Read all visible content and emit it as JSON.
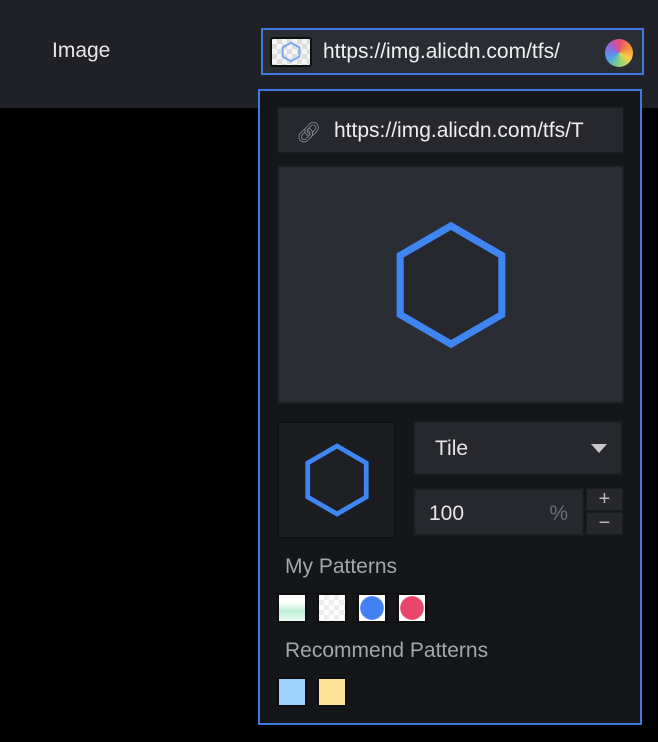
{
  "property_label": "Image",
  "field": {
    "value": "https://img.alicdn.com/tfs/",
    "thumb_icon": "hexagon-thumbnail",
    "color_icon": "color-wheel-icon"
  },
  "popover": {
    "url_input": {
      "icon": "link-icon",
      "value": "https://img.alicdn.com/tfs/T"
    },
    "fill_mode": {
      "selected": "Tile"
    },
    "scale": {
      "value": "100",
      "unit": "%",
      "increment": "+",
      "decrement": "−"
    },
    "my_patterns": {
      "title": "My Patterns",
      "items": [
        {
          "name": "pattern-green"
        },
        {
          "name": "pattern-white"
        },
        {
          "name": "pattern-blue-circle",
          "color": "#4180f0"
        },
        {
          "name": "pattern-red-circle",
          "color": "#e8456a"
        }
      ]
    },
    "recommend_patterns": {
      "title": "Recommend Patterns",
      "items": [
        {
          "name": "light-blue",
          "color": "#9fd3fb"
        },
        {
          "name": "light-yellow",
          "color": "#fde29a"
        }
      ]
    }
  },
  "colors": {
    "accent": "#3d7be0",
    "hexagon": "#3f86f2"
  }
}
